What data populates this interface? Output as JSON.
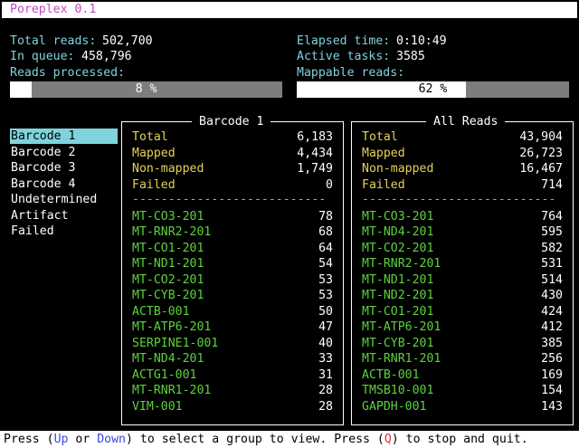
{
  "app": {
    "title": "Poreplex 0.1"
  },
  "stats_left": {
    "total_reads_label": "Total reads:",
    "total_reads_value": "502,700",
    "in_queue_label": "In queue:",
    "in_queue_value": "458,796",
    "reads_processed_label": "Reads processed:",
    "progress_text": "8 %",
    "progress_fraction": 0.08
  },
  "stats_right": {
    "elapsed_label": "Elapsed time:",
    "elapsed_value": "0:10:49",
    "active_tasks_label": "Active tasks:",
    "active_tasks_value": "3585",
    "mappable_label": "Mappable reads:",
    "progress_text": "62 %",
    "progress_fraction": 0.62
  },
  "sidebar": {
    "items": [
      {
        "label": "Barcode 1",
        "selected": true
      },
      {
        "label": "Barcode 2",
        "selected": false
      },
      {
        "label": "Barcode 3",
        "selected": false
      },
      {
        "label": "Barcode 4",
        "selected": false
      },
      {
        "label": "Undetermined",
        "selected": false
      },
      {
        "label": "Artifact",
        "selected": false
      },
      {
        "label": "Failed",
        "selected": false
      }
    ]
  },
  "panels": [
    {
      "title": "Barcode 1",
      "summary": [
        {
          "label": "Total",
          "value": "6,183"
        },
        {
          "label": "Mapped",
          "value": "4,434"
        },
        {
          "label": "Non-mapped",
          "value": "1,749"
        },
        {
          "label": "Failed",
          "value": "0"
        }
      ],
      "divider": "------------------------------",
      "genes": [
        {
          "name": "MT-CO3-201",
          "count": "78"
        },
        {
          "name": "MT-RNR2-201",
          "count": "68"
        },
        {
          "name": "MT-CO1-201",
          "count": "64"
        },
        {
          "name": "MT-ND1-201",
          "count": "54"
        },
        {
          "name": "MT-CO2-201",
          "count": "53"
        },
        {
          "name": "MT-CYB-201",
          "count": "53"
        },
        {
          "name": "ACTB-001",
          "count": "50"
        },
        {
          "name": "MT-ATP6-201",
          "count": "47"
        },
        {
          "name": "SERPINE1-001",
          "count": "40"
        },
        {
          "name": "MT-ND4-201",
          "count": "33"
        },
        {
          "name": "ACTG1-001",
          "count": "31"
        },
        {
          "name": "MT-RNR1-201",
          "count": "28"
        },
        {
          "name": "VIM-001",
          "count": "28"
        }
      ]
    },
    {
      "title": "All Reads",
      "summary": [
        {
          "label": "Total",
          "value": "43,904"
        },
        {
          "label": "Mapped",
          "value": "26,723"
        },
        {
          "label": "Non-mapped",
          "value": "16,467"
        },
        {
          "label": "Failed",
          "value": "714"
        }
      ],
      "divider": "------------------------------",
      "genes": [
        {
          "name": "MT-CO3-201",
          "count": "764"
        },
        {
          "name": "MT-ND4-201",
          "count": "595"
        },
        {
          "name": "MT-CO2-201",
          "count": "582"
        },
        {
          "name": "MT-RNR2-201",
          "count": "531"
        },
        {
          "name": "MT-ND1-201",
          "count": "514"
        },
        {
          "name": "MT-ND2-201",
          "count": "430"
        },
        {
          "name": "MT-CO1-201",
          "count": "424"
        },
        {
          "name": "MT-ATP6-201",
          "count": "412"
        },
        {
          "name": "MT-CYB-201",
          "count": "385"
        },
        {
          "name": "MT-RNR1-201",
          "count": "256"
        },
        {
          "name": "ACTB-001",
          "count": "169"
        },
        {
          "name": "TMSB10-001",
          "count": "154"
        },
        {
          "name": "GAPDH-001",
          "count": "143"
        }
      ]
    }
  ],
  "footer": {
    "part1": "Press (",
    "up": "Up",
    "part2": " or ",
    "down": "Down",
    "part3": ") to select a group to view. Press (",
    "q": "Q",
    "part4": ") to stop and quit."
  },
  "colors": {
    "accent": "#7fd3dc",
    "title": "#c447c4",
    "mapped": "#e6d25a",
    "gene": "#5bd33a",
    "key_nav": "#3b48e0",
    "key_quit": "#e0303a"
  }
}
